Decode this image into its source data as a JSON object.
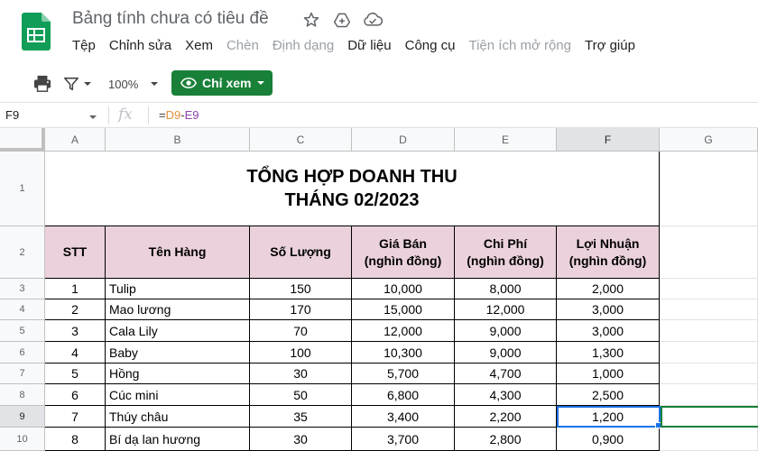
{
  "app": {
    "doc_title": "Bảng tính chưa có tiêu đề",
    "brand_color": "#0f9d58"
  },
  "menu": {
    "items": [
      {
        "label": "Tệp",
        "disabled": false
      },
      {
        "label": "Chỉnh sửa",
        "disabled": false
      },
      {
        "label": "Xem",
        "disabled": false
      },
      {
        "label": "Chèn",
        "disabled": true
      },
      {
        "label": "Định dạng",
        "disabled": true
      },
      {
        "label": "Dữ liệu",
        "disabled": false
      },
      {
        "label": "Công cụ",
        "disabled": false
      },
      {
        "label": "Tiện ích mở rộng",
        "disabled": true
      },
      {
        "label": "Trợ giúp",
        "disabled": false
      }
    ]
  },
  "toolbar": {
    "zoom": "100%",
    "view_mode_label": "Chỉ xem",
    "view_mode_color": "#188038"
  },
  "formula_bar": {
    "cell_ref": "F9",
    "fx": "fx",
    "formula_eq": "=",
    "formula_ref1": "D9",
    "formula_op": "-",
    "formula_ref2": "E9"
  },
  "columns": [
    "A",
    "B",
    "C",
    "D",
    "E",
    "F",
    "G"
  ],
  "selected_column": "F",
  "rows": [
    "1",
    "2",
    "3",
    "4",
    "5",
    "6",
    "7",
    "8",
    "9",
    "10"
  ],
  "selected_row": "9",
  "sheet": {
    "title_line1": "TỔNG HỢP DOANH THU",
    "title_line2": "THÁNG 02/2023",
    "header_color": "#ead1dc",
    "headers": [
      {
        "line1": "STT",
        "line2": ""
      },
      {
        "line1": "Tên Hàng",
        "line2": ""
      },
      {
        "line1": "Số Lượng",
        "line2": ""
      },
      {
        "line1": "Giá Bán",
        "line2": "(nghìn đồng)"
      },
      {
        "line1": "Chi Phí",
        "line2": "(nghìn đồng)"
      },
      {
        "line1": "Lợi Nhuận",
        "line2": "(nghìn đồng)"
      }
    ],
    "data": [
      [
        "1",
        "Tulip",
        "150",
        "10,000",
        "8,000",
        "2,000"
      ],
      [
        "2",
        "Mao lương",
        "170",
        "15,000",
        "12,000",
        "3,000"
      ],
      [
        "3",
        "Cala Lily",
        "70",
        "12,000",
        "9,000",
        "3,000"
      ],
      [
        "4",
        "Baby",
        "100",
        "10,300",
        "9,000",
        "1,300"
      ],
      [
        "5",
        "Hồng",
        "30",
        "5,700",
        "4,700",
        "1,000"
      ],
      [
        "6",
        "Cúc mini",
        "50",
        "6,800",
        "4,300",
        "2,500"
      ],
      [
        "7",
        "Thúy châu",
        "35",
        "3,400",
        "2,200",
        "1,200"
      ],
      [
        "8",
        "Bí dạ lan hương",
        "30",
        "3,700",
        "2,800",
        "0,900"
      ]
    ]
  }
}
